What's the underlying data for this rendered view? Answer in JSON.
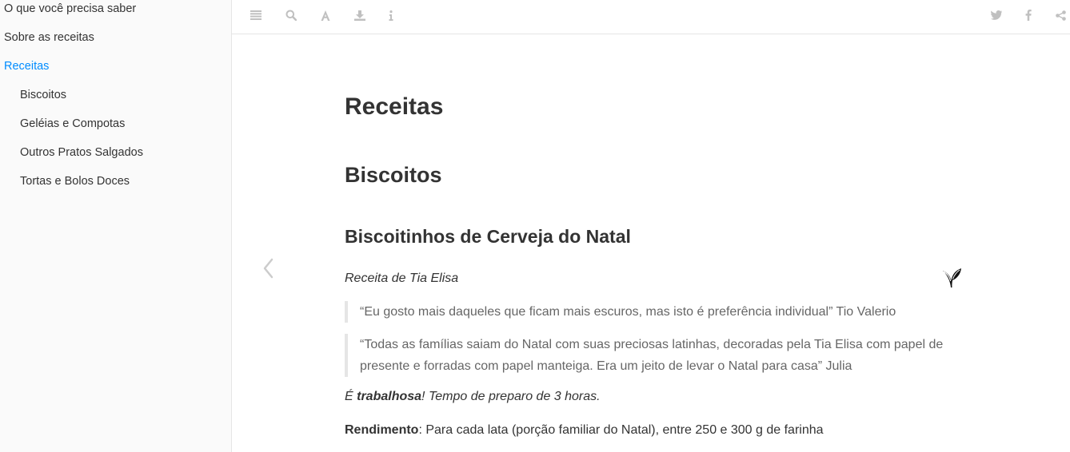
{
  "sidebar": {
    "items": [
      {
        "label": "O que você precisa saber",
        "level": "top",
        "active": false
      },
      {
        "label": "Sobre as receitas",
        "level": "top",
        "active": false
      },
      {
        "label": "Receitas",
        "level": "top",
        "active": true
      },
      {
        "label": "Biscoitos",
        "level": "sub",
        "active": false
      },
      {
        "label": "Geléias e Compotas",
        "level": "sub",
        "active": false
      },
      {
        "label": "Outros Pratos Salgados",
        "level": "sub",
        "active": false
      },
      {
        "label": "Tortas e Bolos Doces",
        "level": "sub",
        "active": false
      }
    ],
    "active_color": "#008cff"
  },
  "toolbar": {
    "left_icons": [
      "menu-icon",
      "search-icon",
      "font-icon",
      "download-icon",
      "info-icon"
    ],
    "right_icons": [
      "twitter-icon",
      "facebook-icon",
      "share-icon"
    ]
  },
  "page": {
    "title": "Receitas",
    "section": "Biscoitos",
    "recipe_title": "Biscoitinhos de Cerveja do Natal",
    "byline": "Receita de Tia Elisa",
    "quotes": [
      "“Eu gosto mais daqueles que ficam mais escuros, mas isto é preferência individual” Tio Valerio",
      "“Todas as famílias saiam do Natal com suas preciosas latinhas, decoradas pela Tia Elisa com papel de presente e forradas com papel manteiga. Era um jeito de levar o Natal para casa” Julia"
    ],
    "note_prefix": "É ",
    "note_bold": "trabalhosa",
    "note_suffix": "! Tempo de preparo de 3 horas.",
    "yield_label": "Rendimento",
    "yield_text": ": Para cada lata (porção familiar do Natal), entre 250 e 300 g de farinha",
    "badge_icon": "vegetarian-leaf-icon"
  }
}
